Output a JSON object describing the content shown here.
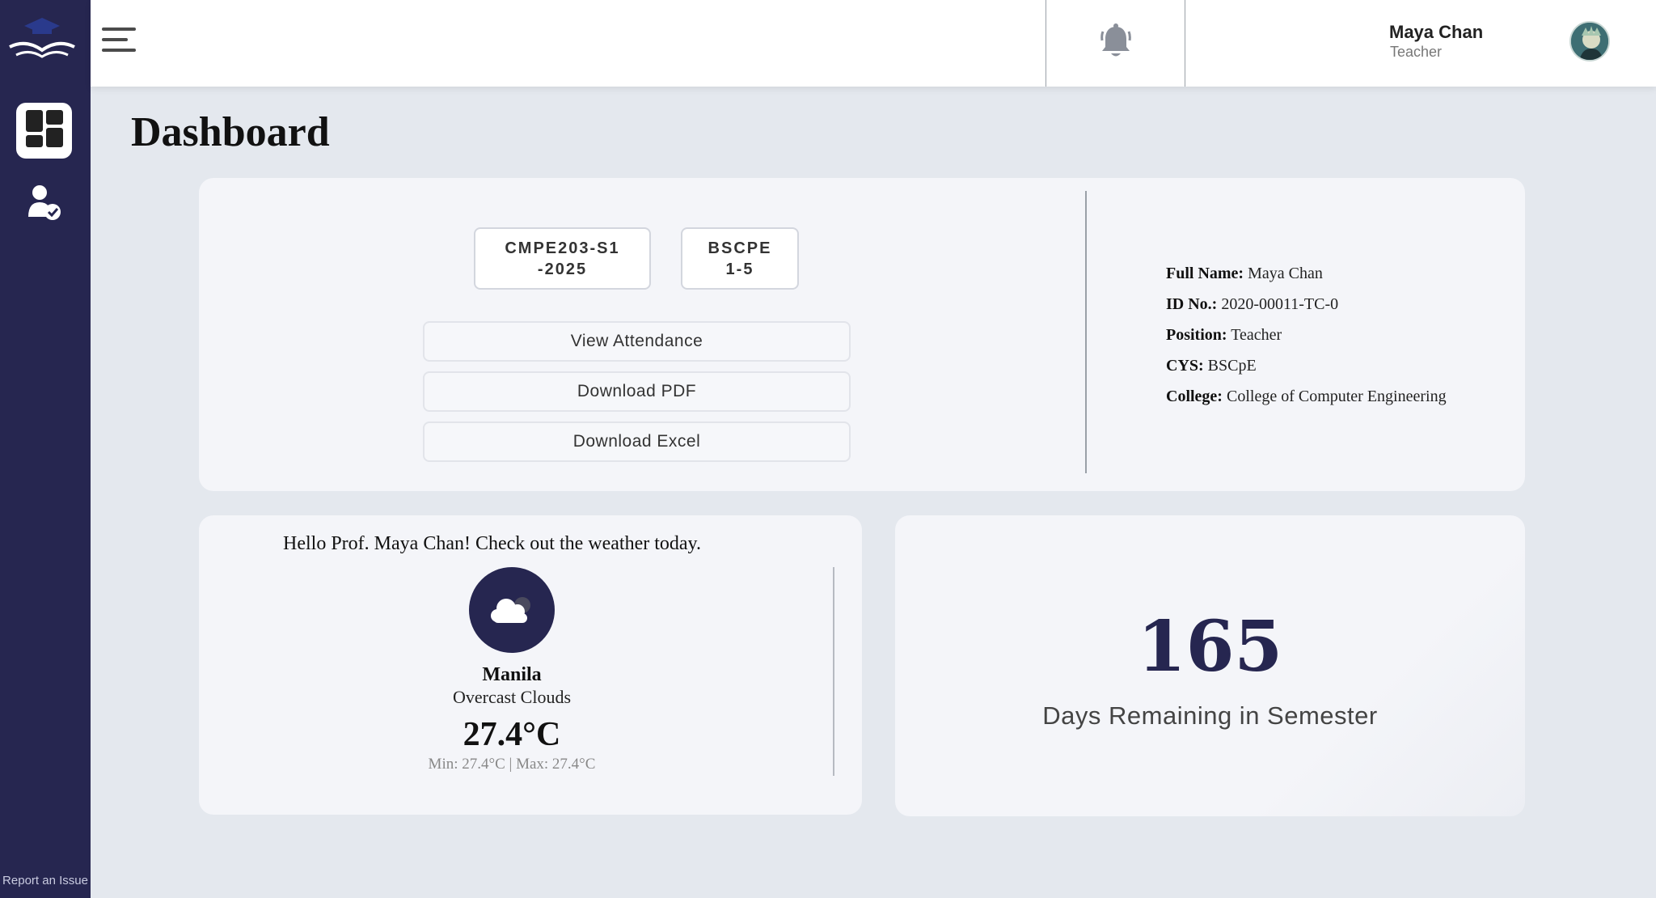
{
  "sidebar": {
    "logo_icon": "graduation-cap-book-logo",
    "items": [
      {
        "icon": "dashboard-grid-icon",
        "active": true
      },
      {
        "icon": "user-check-icon",
        "active": false
      }
    ],
    "report_label": "Report an Issue"
  },
  "header": {
    "menu_icon": "hamburger-menu-icon",
    "notification_icon": "bell-icon",
    "user": {
      "name": "Maya Chan",
      "role": "Teacher"
    }
  },
  "page": {
    "title": "Dashboard"
  },
  "class_panel": {
    "course_code": "CMPE203-S1-2025",
    "section": "BSCPE 1-5",
    "buttons": {
      "view_attendance": "View Attendance",
      "download_pdf": "Download PDF",
      "download_excel": "Download Excel"
    }
  },
  "profile": {
    "full_name_label": "Full Name:",
    "full_name": "Maya Chan",
    "id_label": "ID No.:",
    "id": "2020-00011-TC-0",
    "position_label": "Position:",
    "position": "Teacher",
    "cys_label": "CYS:",
    "cys": "BSCpE",
    "college_label": "College:",
    "college": "College of Computer Engineering"
  },
  "weather": {
    "greeting": "Hello Prof. Maya Chan! Check out the weather today.",
    "icon": "cloud-icon",
    "city": "Manila",
    "condition": "Overcast Clouds",
    "temperature": "27.4°C",
    "min_max": "Min: 27.4°C | Max: 27.4°C"
  },
  "semester": {
    "days_remaining": "165",
    "label": "Days Remaining in Semester"
  },
  "colors": {
    "sidebar_bg": "#262650",
    "accent": "#262650",
    "page_bg": "#e4e8ee",
    "card_bg": "#f4f5f9"
  }
}
